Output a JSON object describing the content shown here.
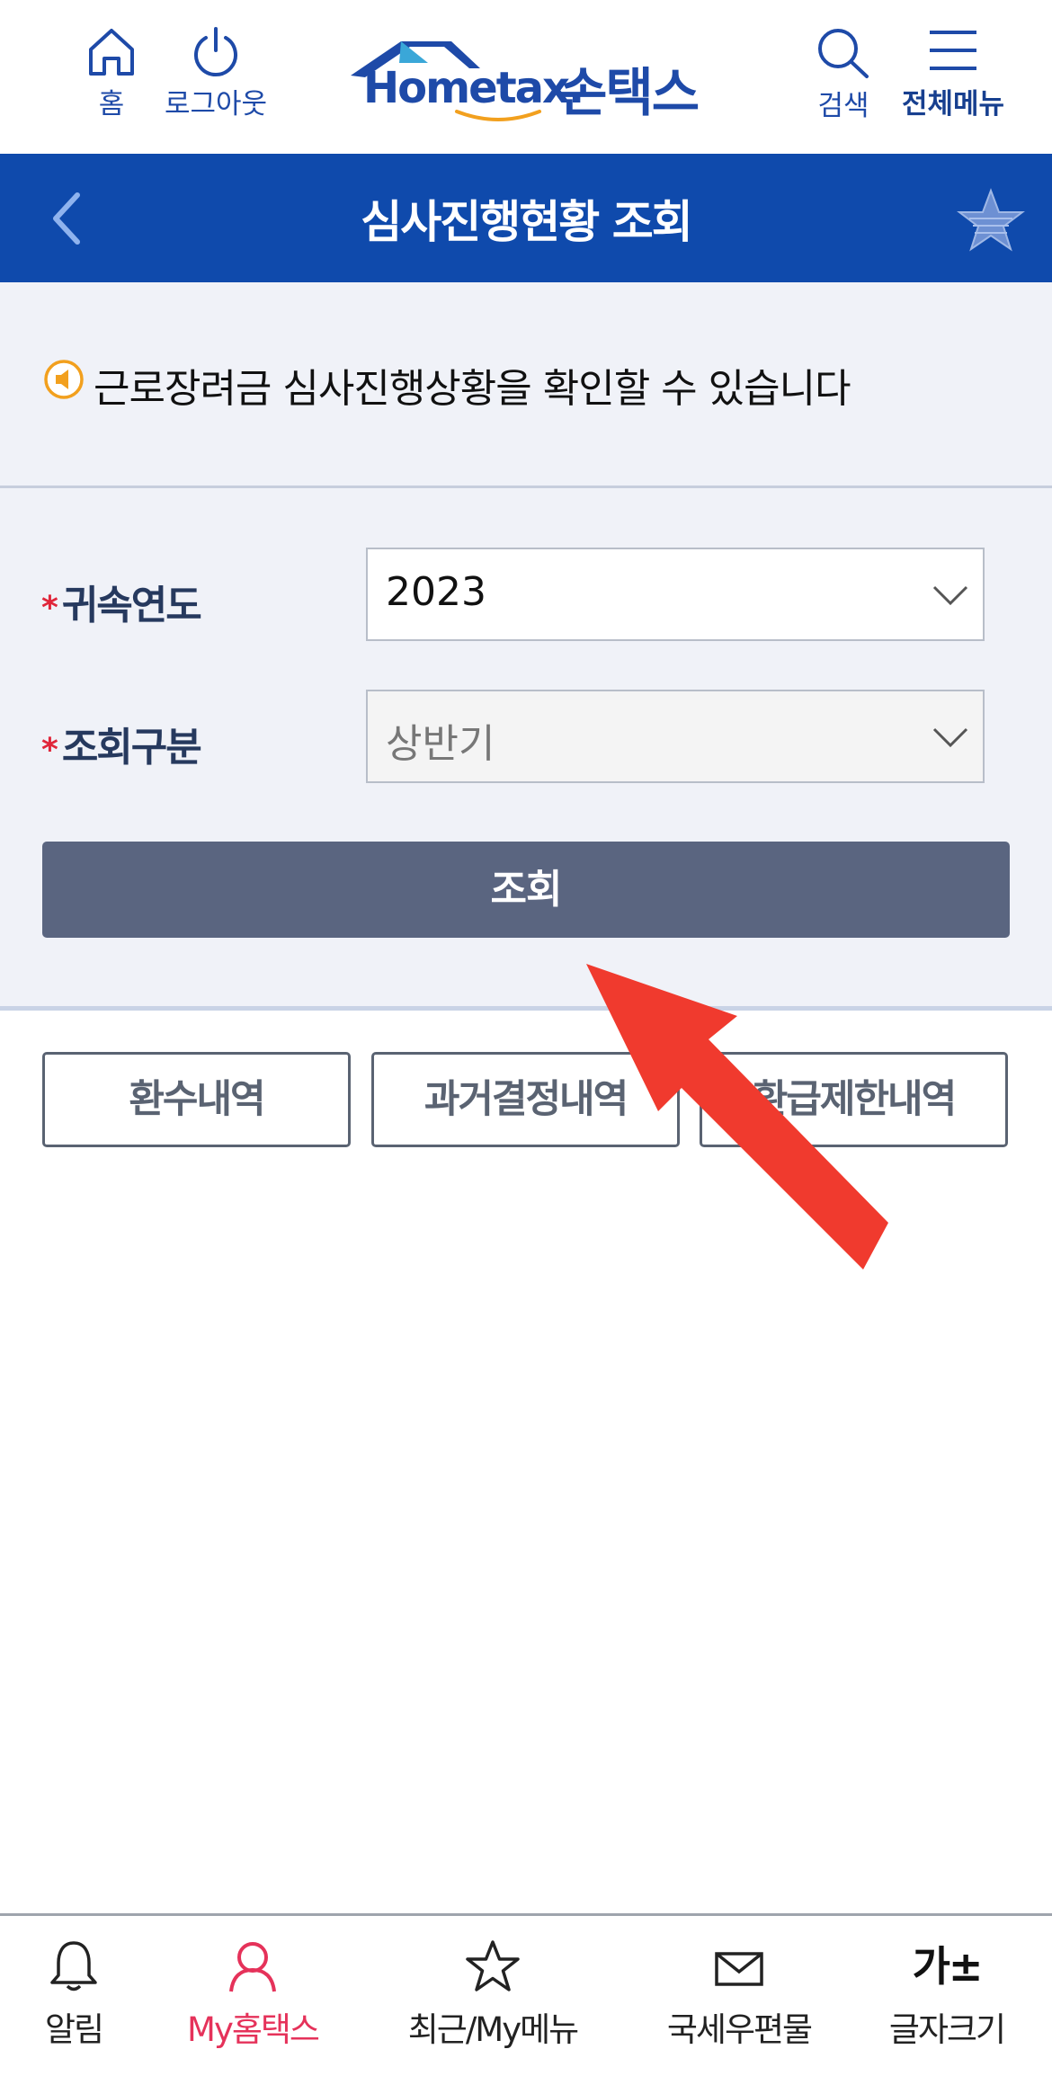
{
  "header": {
    "home_label": "홈",
    "logout_label": "로그아웃",
    "logo_text": "Hometax.",
    "logo_korean": "손택스",
    "search_label": "검색",
    "menu_label": "전체메뉴"
  },
  "titlebar": {
    "title": "심사진행현황 조회"
  },
  "notice": {
    "text": "근로장려금 심사진행상황을 확인할 수 있습니다"
  },
  "form": {
    "year_label": "귀속연도",
    "year_value": "2023",
    "type_label": "조회구분",
    "type_value": "상반기",
    "required_mark": "*",
    "search_button": "조회"
  },
  "actions": {
    "refund_recovery": "환수내역",
    "past_decisions": "과거결정내역",
    "refund_limits": "환급제한내역"
  },
  "bottom_nav": {
    "items": [
      {
        "label": "알림",
        "icon": "bell-icon"
      },
      {
        "label": "My홈택스",
        "icon": "user-icon",
        "active": true
      },
      {
        "label": "최근/My메뉴",
        "icon": "star-icon"
      },
      {
        "label": "국세우편물",
        "icon": "mail-icon"
      },
      {
        "label": "글자크기",
        "icon": "font-size-icon",
        "glyph": "가±"
      }
    ]
  },
  "colors": {
    "brand_blue": "#0f4aac",
    "button_gray": "#5a6580",
    "active_pink": "#e5325a",
    "arrow_red": "#f03a2e"
  }
}
